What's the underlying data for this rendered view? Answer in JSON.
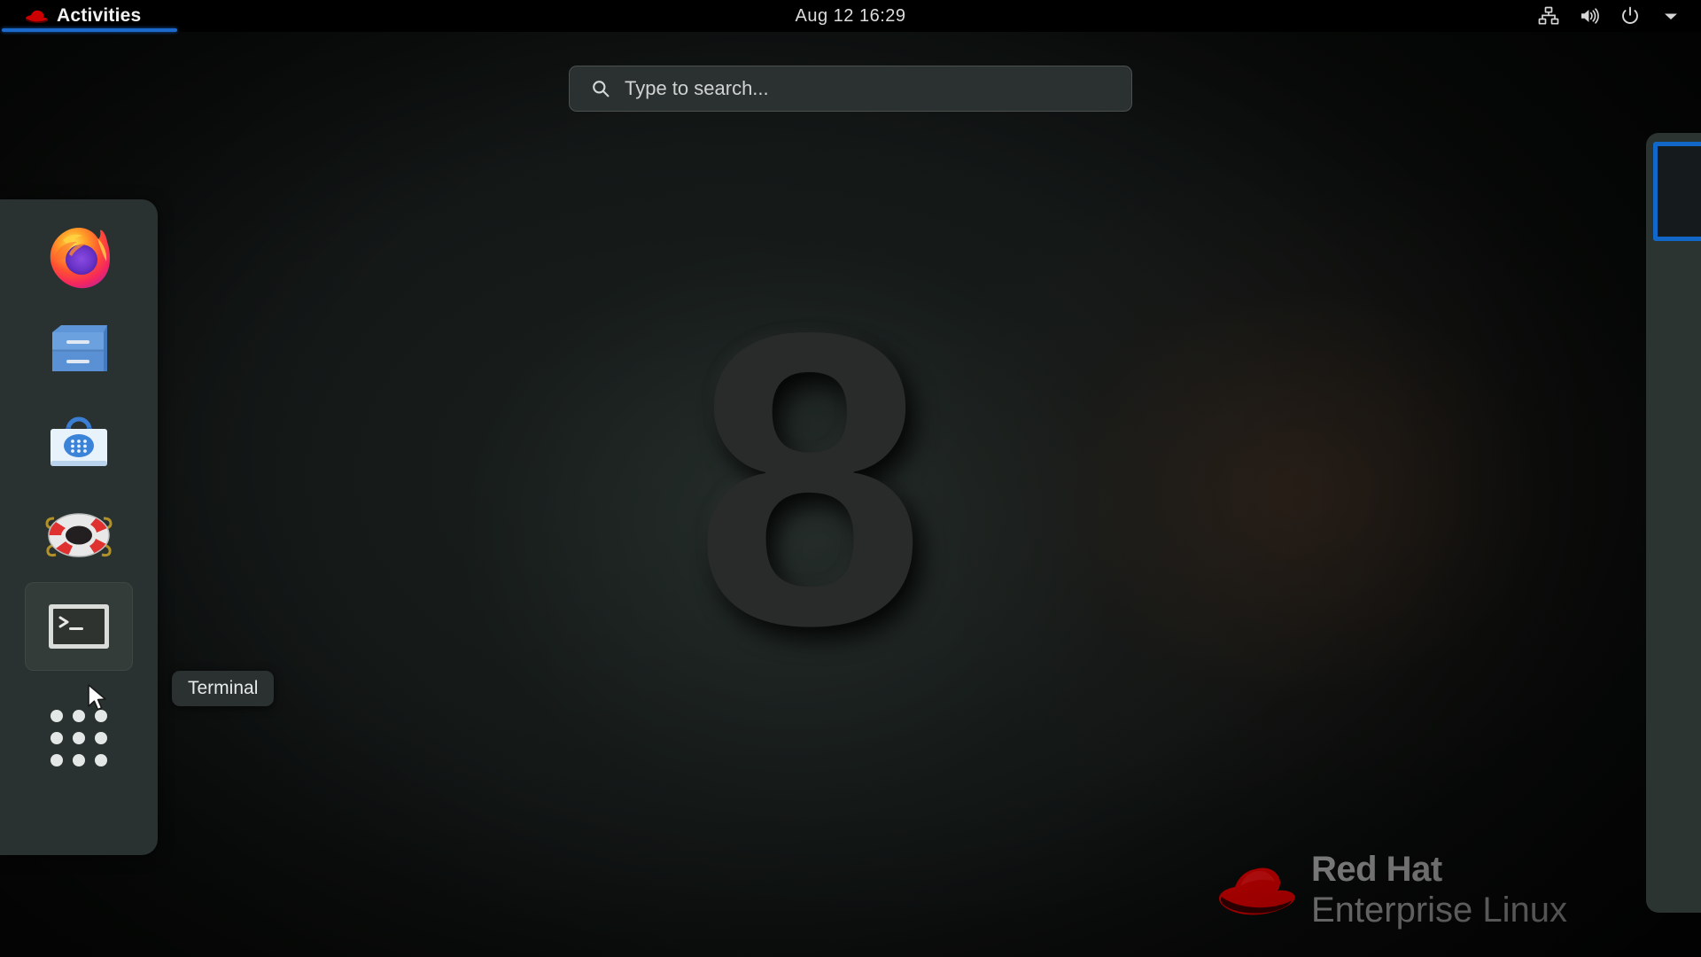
{
  "topbar": {
    "activities_label": "Activities",
    "activities_icon": "redhat-logo-icon",
    "clock": "Aug 12  16:29",
    "system_icons": [
      {
        "name": "network-wired-icon",
        "label": "Network"
      },
      {
        "name": "volume-icon",
        "label": "Volume"
      },
      {
        "name": "power-icon",
        "label": "Power"
      },
      {
        "name": "chevron-down-icon",
        "label": "System menu"
      }
    ]
  },
  "search": {
    "placeholder": "Type to search...",
    "value": "",
    "icon": "search-icon"
  },
  "dock": {
    "items": [
      {
        "name": "firefox",
        "label": "Firefox",
        "icon": "firefox-icon",
        "running": false
      },
      {
        "name": "files",
        "label": "Files",
        "icon": "file-cabinet-icon",
        "running": false
      },
      {
        "name": "software",
        "label": "Software",
        "icon": "shopping-bag-icon",
        "running": false
      },
      {
        "name": "help",
        "label": "Help",
        "icon": "life-ring-icon",
        "running": false
      },
      {
        "name": "terminal",
        "label": "Terminal",
        "icon": "terminal-icon",
        "running": true
      }
    ],
    "show_apps_label": "Show Applications",
    "show_apps_icon": "app-grid-icon"
  },
  "tooltip": {
    "text": "Terminal"
  },
  "workspaces": {
    "active_index": 0,
    "count": 1,
    "active_border_color": "#1268c9"
  },
  "desktop": {
    "watermark": "8",
    "brand_line1": "Red Hat",
    "brand_line2": "Enterprise Linux",
    "brand_icon": "redhat-fedora-icon"
  },
  "colors": {
    "dock_bg": "#293230",
    "topbar_bg": "#000000",
    "accent_blue": "#1b6acb",
    "search_bg": "#2b3130",
    "redhat_red": "#cc0000"
  }
}
